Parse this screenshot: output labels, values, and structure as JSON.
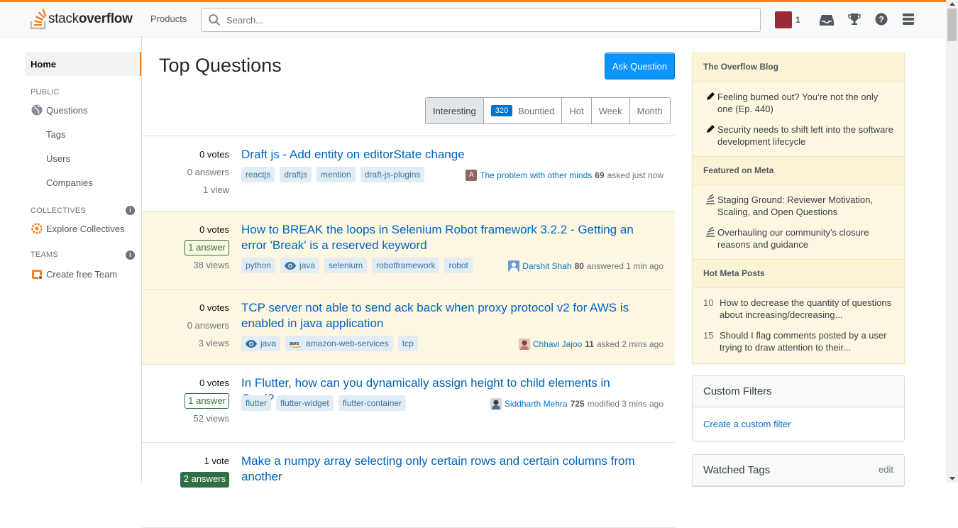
{
  "header": {
    "logo_text_light": "stack",
    "logo_text_bold": "overflow",
    "products": "Products",
    "search_placeholder": "Search...",
    "reputation": "1"
  },
  "leftnav": {
    "home": "Home",
    "public_label": "PUBLIC",
    "questions": "Questions",
    "tags": "Tags",
    "users": "Users",
    "companies": "Companies",
    "collectives_label": "COLLECTIVES",
    "explore_collectives": "Explore Collectives",
    "teams_label": "TEAMS",
    "create_team": "Create free Team"
  },
  "main": {
    "title": "Top Questions",
    "ask_button": "Ask Question",
    "filters": [
      "Interesting",
      "Bountied",
      "Hot",
      "Week",
      "Month"
    ],
    "bounty_count": "320"
  },
  "questions": [
    {
      "votes": "0 votes",
      "answers": "0 answers",
      "views": "1 view",
      "title": "Draft js - Add entity on editorState change",
      "tags": [
        "reactjs",
        "draftjs",
        "mention",
        "draft-js-plugins"
      ],
      "user": "The problem with other minds",
      "rep": "69",
      "action": "asked just now"
    },
    {
      "votes": "0 votes",
      "answers": "1 answer",
      "views": "38 views",
      "title": "How to BREAK the loops in Selenium Robot framework 3.2.2 - Getting an error 'Break' is a reserved keyword",
      "tags": [
        "python",
        "java",
        "selenium",
        "robotframework",
        "robot"
      ],
      "user": "Darshit Shah",
      "rep": "80",
      "action": "answered 1 min ago"
    },
    {
      "votes": "0 votes",
      "answers": "0 answers",
      "views": "3 views",
      "title": "TCP server not able to send ack back when proxy protocol v2 for AWS is enabled in java application",
      "tags": [
        "java",
        "amazon-web-services",
        "tcp"
      ],
      "user": "Chhavi Jajoo",
      "rep": "11",
      "action": "asked 2 mins ago"
    },
    {
      "votes": "0 votes",
      "answers": "1 answer",
      "views": "52 views",
      "title": "In Flutter, how can you dynamically assign height to child elements in Card?",
      "tags": [
        "flutter",
        "flutter-widget",
        "flutter-container"
      ],
      "user": "Siddharth Mehra",
      "rep": "725",
      "action": "modified 3 mins ago"
    },
    {
      "votes": "1 vote",
      "answers": "2 answers",
      "views": "",
      "title": "Make a numpy array selecting only certain rows and certain columns from another",
      "tags": [],
      "user": "",
      "rep": "",
      "action": ""
    }
  ],
  "sidebar": {
    "blog_title": "The Overflow Blog",
    "blog_items": [
      "Feeling burned out? You’re not the only one (Ep. 440)",
      "Security needs to shift left into the software development lifecycle"
    ],
    "meta_title": "Featured on Meta",
    "meta_items": [
      "Staging Ground: Reviewer Motivation, Scaling, and Open Questions",
      "Overhauling our community's closure reasons and guidance"
    ],
    "hot_title": "Hot Meta Posts",
    "hot_items": [
      {
        "num": "10",
        "text": "How to decrease the quantity of questions about increasing/decreasing..."
      },
      {
        "num": "15",
        "text": "Should I flag comments posted by a user trying to draw attention to their..."
      }
    ],
    "custom_filters_title": "Custom Filters",
    "custom_filter_link": "Create a custom filter",
    "watched_tags_title": "Watched Tags",
    "watched_tags_edit": "edit"
  },
  "colors": {
    "accent": "#f48225",
    "link": "#0063bf",
    "answered": "#2f6f44",
    "primary_button": "#0a95ff"
  }
}
